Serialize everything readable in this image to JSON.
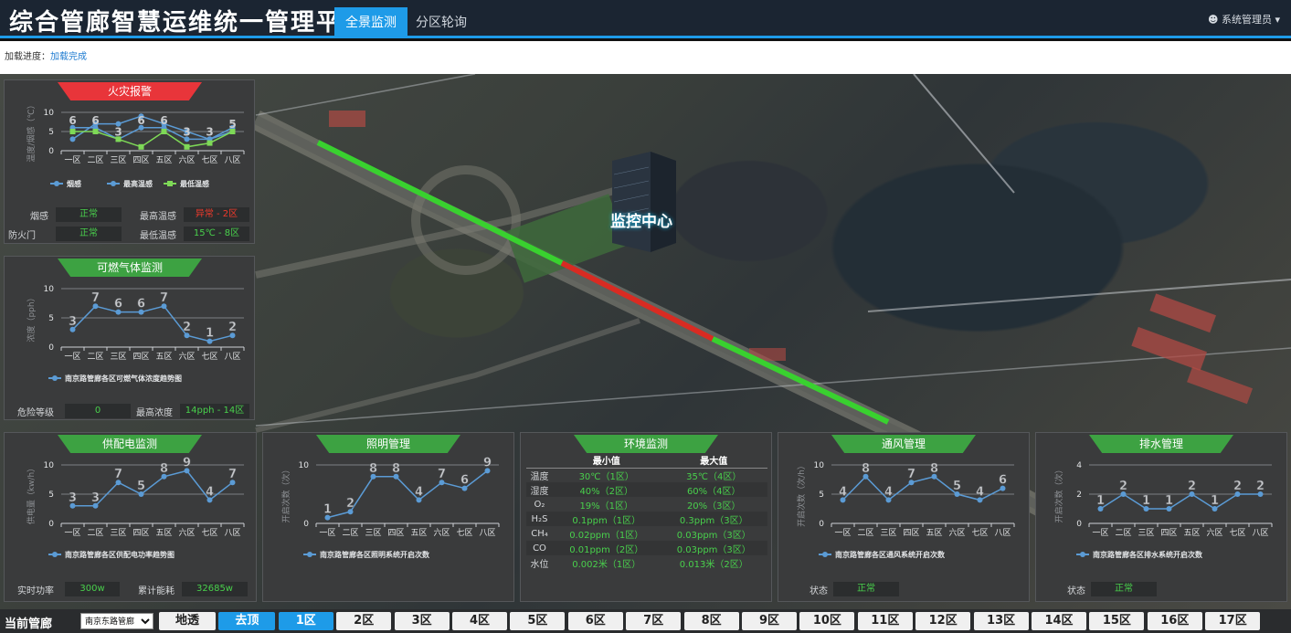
{
  "header": {
    "title": "综合管廊智慧运维统一管理平台",
    "tabs": [
      {
        "label": "全景监测",
        "active": true
      },
      {
        "label": "分区轮询",
        "active": false
      }
    ],
    "user": "系统管理员"
  },
  "load": {
    "label": "加载进度：",
    "value": "加载完成"
  },
  "map": {
    "center_label": "监控中心"
  },
  "fire": {
    "title": "火灾报警",
    "yaxis_label": "温度/烟感（℃）",
    "yticks": [
      "0",
      "5",
      "10"
    ],
    "chart_data": {
      "type": "line",
      "categories": [
        "一区",
        "二区",
        "三区",
        "四区",
        "五区",
        "六区",
        "七区",
        "八区"
      ],
      "ylim": [
        0,
        10
      ],
      "series": [
        {
          "name": "烟感",
          "values": [
            3,
            7,
            7,
            9,
            7,
            5,
            3,
            6
          ],
          "color": "#5b9bd5"
        },
        {
          "name": "最高温感",
          "values": [
            6,
            6,
            3,
            6,
            6,
            3,
            3,
            5
          ],
          "color": "#5b9bd5"
        },
        {
          "name": "最低温感",
          "values": [
            5,
            5,
            3,
            1,
            5,
            1,
            2,
            5
          ],
          "color": "#7ed957"
        }
      ],
      "labels": [
        "6",
        "6",
        "",
        "9",
        "6",
        "5",
        "",
        "5",
        "3",
        "7",
        "",
        "1",
        "7",
        "1",
        "2",
        ""
      ]
    },
    "legend": [
      "烟感",
      "最高温感",
      "最低温感"
    ],
    "rows": [
      {
        "label1": "烟感",
        "value1": "正常",
        "label2": "最高温感",
        "value2": "异常 - 2区"
      },
      {
        "label1": "防火门",
        "value1": "正常",
        "label2": "最低温感",
        "value2": "15℃ - 8区"
      }
    ]
  },
  "gas": {
    "title": "可燃气体监测",
    "yaxis_label": "浓度（pph）",
    "yticks": [
      "0",
      "5",
      "10"
    ],
    "chart_data": {
      "type": "line",
      "categories": [
        "一区",
        "二区",
        "三区",
        "四区",
        "五区",
        "六区",
        "七区",
        "八区"
      ],
      "ylim": [
        0,
        10
      ],
      "series": [
        {
          "name": "南京路管廊各区可燃气体浓度趋势图",
          "values": [
            3,
            7,
            6,
            6,
            7,
            2,
            1,
            2
          ],
          "color": "#5b9bd5"
        }
      ]
    },
    "legend": "南京路管廊各区可燃气体浓度趋势图",
    "row": {
      "label1": "危险等级",
      "value1": "0",
      "label2": "最高浓度",
      "value2": "14pph - 14区"
    }
  },
  "power": {
    "title": "供配电监测",
    "yaxis_label": "供电量（kw/h）",
    "yticks": [
      "0",
      "5",
      "10"
    ],
    "chart_data": {
      "type": "line",
      "categories": [
        "一区",
        "二区",
        "三区",
        "四区",
        "五区",
        "六区",
        "七区",
        "八区"
      ],
      "ylim": [
        0,
        10
      ],
      "series": [
        {
          "name": "南京路管廊各区供配电功率趋势图",
          "values": [
            3,
            3,
            7,
            5,
            8,
            9,
            4,
            7
          ],
          "color": "#5b9bd5"
        }
      ]
    },
    "legend": "南京路管廊各区供配电功率趋势图",
    "row": {
      "label1": "实时功率",
      "value1": "300w",
      "label2": "累计能耗",
      "value2": "32685w"
    }
  },
  "lighting": {
    "title": "照明管理",
    "yaxis_label": "开启次数（次）",
    "yticks": [
      "0",
      "10"
    ],
    "chart_data": {
      "type": "line",
      "categories": [
        "一区",
        "二区",
        "三区",
        "四区",
        "五区",
        "六区",
        "七区",
        "八区"
      ],
      "ylim": [
        0,
        10
      ],
      "series": [
        {
          "name": "南京路管廊各区照明系统开启次数",
          "values": [
            1,
            2,
            8,
            8,
            4,
            7,
            6,
            9
          ],
          "color": "#5b9bd5"
        }
      ]
    },
    "legend": "南京路管廊各区照明系统开启次数"
  },
  "env": {
    "title": "环境监测",
    "headers": [
      "",
      "最小值",
      "最大值"
    ],
    "rows": [
      {
        "name": "温度",
        "min": "30℃（1区）",
        "max": "35℃（4区）"
      },
      {
        "name": "湿度",
        "min": "40%（2区）",
        "max": "60%（4区）"
      },
      {
        "name": "O₂",
        "min": "19%（1区）",
        "max": "20%（3区）"
      },
      {
        "name": "H₂S",
        "min": "0.1ppm（1区）",
        "max": "0.3ppm（3区）"
      },
      {
        "name": "CH₄",
        "min": "0.02ppm（1区）",
        "max": "0.03ppm（3区）"
      },
      {
        "name": "CO",
        "min": "0.01ppm（2区）",
        "max": "0.03ppm（3区）"
      },
      {
        "name": "水位",
        "min": "0.002米（1区）",
        "max": "0.013米（2区）"
      }
    ]
  },
  "ventilation": {
    "title": "通风管理",
    "yaxis_label": "开启次数（次/h）",
    "yticks": [
      "0",
      "5",
      "10"
    ],
    "chart_data": {
      "type": "line",
      "categories": [
        "一区",
        "二区",
        "三区",
        "四区",
        "五区",
        "六区",
        "七区",
        "八区"
      ],
      "ylim": [
        0,
        10
      ],
      "series": [
        {
          "name": "南京路管廊各区通风系统开启次数",
          "values": [
            4,
            8,
            4,
            7,
            8,
            5,
            4,
            6
          ],
          "color": "#5b9bd5"
        }
      ]
    },
    "legend": "南京路管廊各区通风系统开启次数",
    "row": {
      "label1": "状态",
      "value1": "正常"
    }
  },
  "drainage": {
    "title": "排水管理",
    "yaxis_label": "开启次数（次）",
    "yticks": [
      "0",
      "2",
      "4"
    ],
    "chart_data": {
      "type": "line",
      "categories": [
        "一区",
        "二区",
        "三区",
        "四区",
        "五区",
        "六区",
        "七区",
        "八区"
      ],
      "ylim": [
        0,
        4
      ],
      "series": [
        {
          "name": "南京路管廊各区排水系统开启次数",
          "values": [
            1,
            2,
            1,
            1,
            2,
            1,
            2,
            2
          ],
          "color": "#5b9bd5"
        }
      ]
    },
    "legend": "南京路管廊各区排水系统开启次数",
    "row": {
      "label1": "状态",
      "value1": "正常"
    }
  },
  "bottom": {
    "current_label": "当前管廊",
    "select_value": "南京东路管廊",
    "buttons": [
      "地透",
      "去顶",
      "1区",
      "2区",
      "3区",
      "4区",
      "5区",
      "6区",
      "7区",
      "8区",
      "9区",
      "10区",
      "11区",
      "12区",
      "13区",
      "14区",
      "15区",
      "16区",
      "17区"
    ],
    "active": [
      "去顶",
      "1区"
    ]
  }
}
